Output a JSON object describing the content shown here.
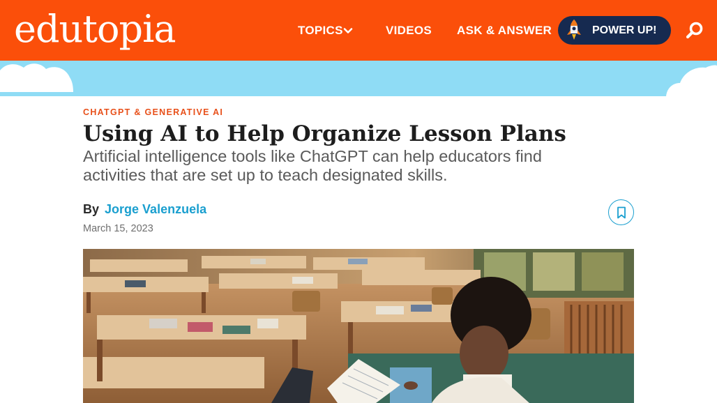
{
  "header": {
    "logo_text": "edutopia",
    "nav": {
      "topics": "TOPICS",
      "videos": "VIDEOS",
      "ask": "ASK & ANSWER"
    },
    "powerup_label": "POWER UP!",
    "colors": {
      "brand": "#fb4f0a",
      "powerup_bg": "#162a50"
    }
  },
  "icons": {
    "topics_chevron": "chevron-down-icon",
    "powerup": "rocket-icon",
    "search": "search-icon",
    "bookmark": "bookmark-icon"
  },
  "article": {
    "category": "CHATGPT & GENERATIVE AI",
    "title": "Using AI to Help Organize Lesson Plans",
    "subtitle": "Artificial intelligence tools like ChatGPT can help educators find activities that are set up to teach designated skills.",
    "by_label": "By",
    "author": "Jorge Valenzuela",
    "date": "March 15, 2023",
    "colors": {
      "category": "#e8501a",
      "author_link": "#1a9fcf"
    }
  },
  "hero_image": {
    "description_icon": "classroom-photo"
  }
}
